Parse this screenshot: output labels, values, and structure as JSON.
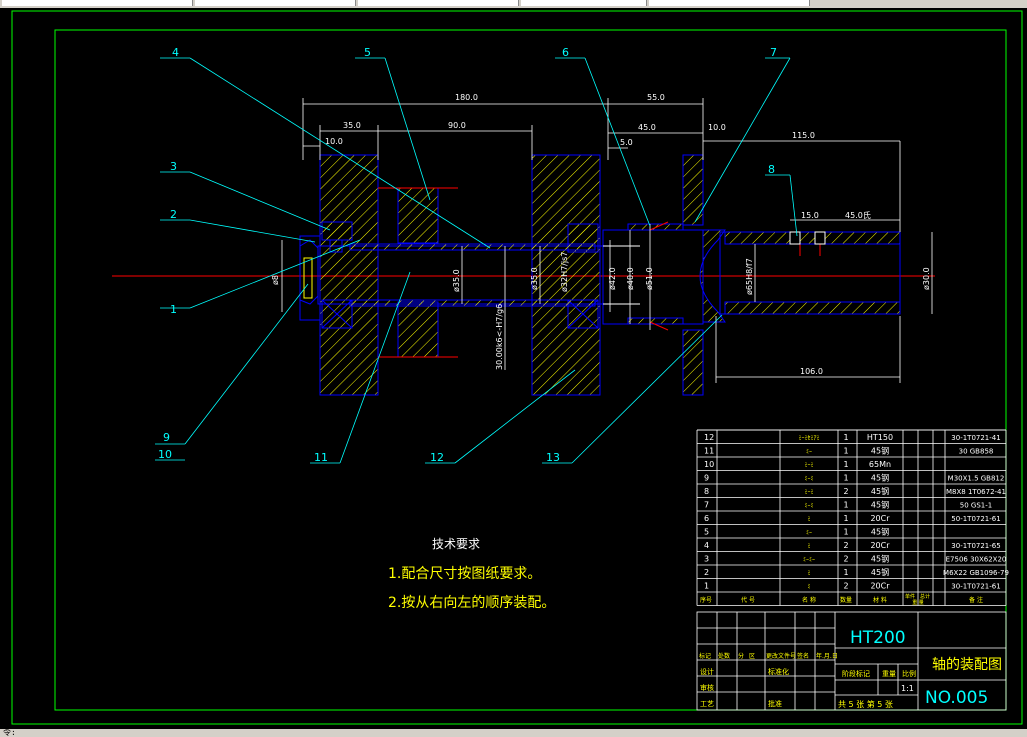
{
  "window": {
    "command_prompt": "令:"
  },
  "drawing": {
    "dimensions": {
      "d180": "180.0",
      "d55": "55.0",
      "d35": "35.0",
      "d90": "90.0",
      "d10a": "10.0",
      "d45": "45.0",
      "d10b": "10.0",
      "d5": "5.0",
      "d115": "115.0",
      "d15": "15.0",
      "d45b": "45.0氏",
      "d106": "106.0",
      "phi35": "ø35.0",
      "phi35b": "ø35.0",
      "fit1": "ø32H7/js7",
      "fit2": "30.00k6<-H7/g6",
      "phi42": "ø42.0",
      "phi40": "ø40.0",
      "phi51": "ø51.0",
      "phi65": "ø65H8/f7",
      "phi30": "ø30.0",
      "phi8": "ø8"
    },
    "balloons": [
      "1",
      "2",
      "3",
      "4",
      "5",
      "6",
      "7",
      "8",
      "9",
      "10",
      "11",
      "12",
      "13"
    ],
    "notes": {
      "title": "技术要求",
      "line1": "1.配合尺寸按图纸要求。",
      "line2": "2.按从右向左的顺序装配。"
    }
  },
  "bom": {
    "rows": [
      {
        "no": "12",
        "name": "ﾐｰﾐｾﾐｱﾐ",
        "qty": "1",
        "material": "HT150",
        "code": "30-1T0721-41"
      },
      {
        "no": "11",
        "name": "ﾐｰ",
        "qty": "1",
        "material": "45钢",
        "code": "30 GB858"
      },
      {
        "no": "10",
        "name": "ﾐｰﾐ",
        "qty": "1",
        "material": "65Mn",
        "code": ""
      },
      {
        "no": "9",
        "name": "ﾐｰﾐ",
        "qty": "1",
        "material": "45钢",
        "code": "M30X1.5 GB812"
      },
      {
        "no": "8",
        "name": "ﾐｰﾐ",
        "qty": "2",
        "material": "45钢",
        "code": "M8X8 1T0672-41"
      },
      {
        "no": "7",
        "name": "ﾐｰﾐ",
        "qty": "1",
        "material": "45钢",
        "code": "50 GS1-1"
      },
      {
        "no": "6",
        "name": "ﾐ",
        "qty": "1",
        "material": "20Cr",
        "code": "50-1T0721-61"
      },
      {
        "no": "5",
        "name": "ﾐｰ",
        "qty": "1",
        "material": "45钢",
        "code": ""
      },
      {
        "no": "4",
        "name": "ﾐ",
        "qty": "2",
        "material": "20Cr",
        "code": "30-1T0721-65"
      },
      {
        "no": "3",
        "name": "ﾐｰﾐｰ",
        "qty": "2",
        "material": "45钢",
        "code": "E7506 30X62X20"
      },
      {
        "no": "2",
        "name": "ﾐ",
        "qty": "1",
        "material": "45钢",
        "code": "M6X22 GB1096-79"
      },
      {
        "no": "1",
        "name": "ﾐ",
        "qty": "2",
        "material": "20Cr",
        "code": "30-1T0721-61"
      }
    ],
    "header": {
      "no": "序号",
      "code": "代 号",
      "name": "名 称",
      "qty": "数量",
      "material": "材 料",
      "unit": "单件",
      "total": "总计",
      "weight": "重 量",
      "remark": "备 注"
    }
  },
  "titleblock": {
    "material": "HT200",
    "title": "轴的装配图",
    "number": "NO.005",
    "scale": "1:1",
    "sheets": "共 5 张 第 5 张",
    "rev_labels": [
      "标记",
      "处数",
      "分",
      "区",
      "更改文件号",
      "签名",
      "年.月.日"
    ],
    "role_labels": [
      "设计",
      "标准化",
      "审核",
      "工艺",
      "批准"
    ],
    "stage_labels": [
      "阶段标记",
      "重量",
      "比例"
    ]
  },
  "colors": {
    "background": "#000000",
    "border": "#00ff00",
    "outline": "#0000ff",
    "centerline": "#ff0000",
    "dimension": "#ffffff",
    "leader": "#00ffff",
    "hatch": "#ffff00",
    "note_text": "#ffff00"
  }
}
